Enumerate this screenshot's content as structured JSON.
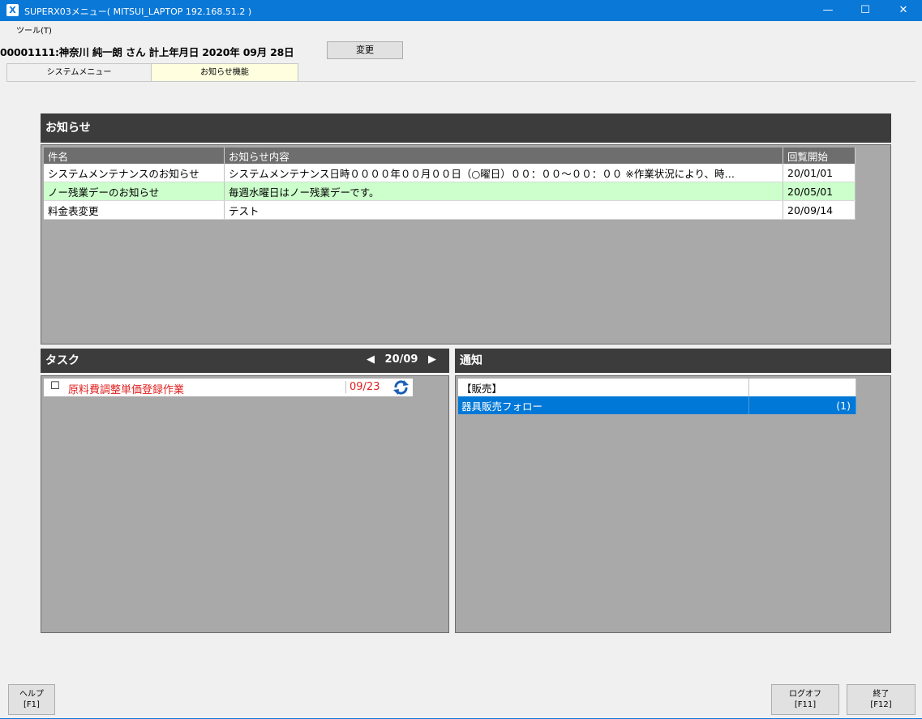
{
  "window": {
    "app_icon": "X",
    "title": "SUPERX03メニュー( MITSUI_LAPTOP 192.168.51.2 )",
    "minimize": "—",
    "maximize": "☐",
    "close": "✕"
  },
  "menu": {
    "tools": "ツール(T)"
  },
  "header": {
    "user_info": "00001111:神奈川 純一朗 さん 計上年月日 2020年 09月 28日",
    "change_button": "変更"
  },
  "tabs": [
    {
      "label": "システムメニュー"
    },
    {
      "label": "お知らせ機能"
    }
  ],
  "notices": {
    "title": "お知らせ",
    "columns": [
      "件名",
      "お知らせ内容",
      "回覧開始"
    ],
    "rows": [
      {
        "subject": "システムメンテナンスのお知らせ",
        "content": "システムメンテナンス日時００００年００月００日（○曜日）００：００～００：００ ※作業状況により、時…",
        "start": "20/01/01"
      },
      {
        "subject": "ノー残業デーのお知らせ",
        "content": "毎週水曜日はノー残業デーです。",
        "start": "20/05/01"
      },
      {
        "subject": "料金表変更",
        "content": "テスト",
        "start": "20/09/14"
      }
    ]
  },
  "tasks": {
    "title": "タスク",
    "prev": "◀",
    "month": "20/09",
    "next": "▶",
    "items": [
      {
        "checkbox": "☐",
        "title": "原料費調整単価登録作業",
        "date": "09/23"
      }
    ]
  },
  "notifications": {
    "title": "通知",
    "rows": [
      {
        "label": "【販売】",
        "count": ""
      },
      {
        "label": "器具販売フォロー",
        "count": "(1)"
      }
    ]
  },
  "footer": {
    "help": {
      "label": "ヘルプ",
      "key": "[F1]"
    },
    "logoff": {
      "label": "ログオフ",
      "key": "[F11]"
    },
    "exit": {
      "label": "終了",
      "key": "[F12]"
    }
  },
  "colors": {
    "titlebar": "#0a78d7",
    "panel_header": "#3c3c3c",
    "grey_area": "#a9a9a9",
    "highlight_row": "#ccffcc",
    "selected_row": "#0078d7",
    "task_text": "#e02020",
    "active_tab": "#ffffe0"
  }
}
